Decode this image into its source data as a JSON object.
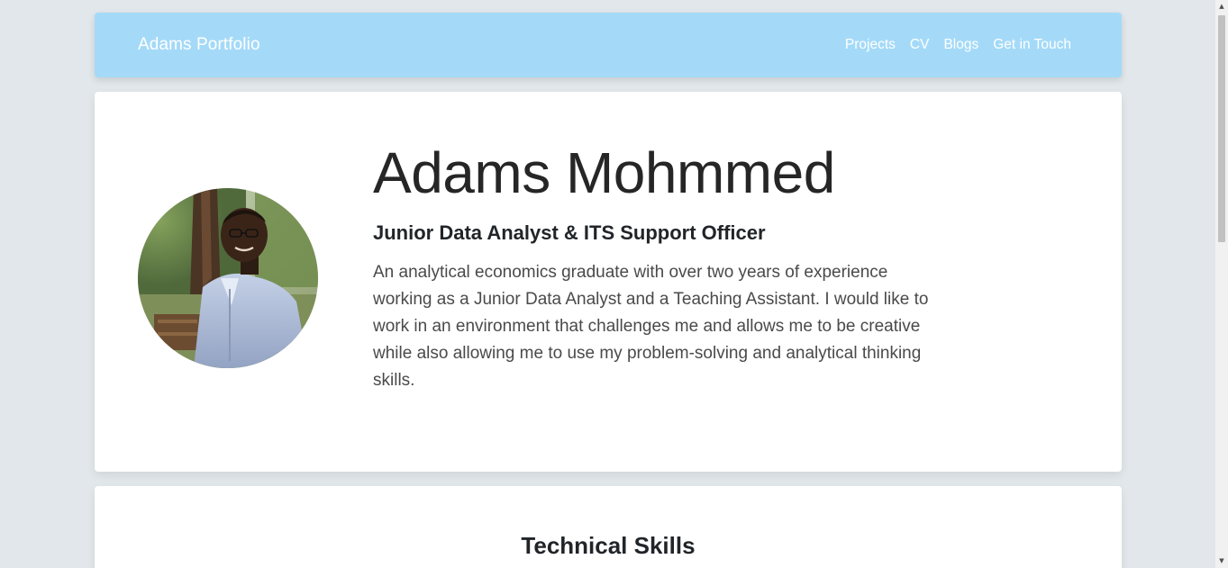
{
  "navbar": {
    "brand": "Adams Portfolio",
    "links": [
      "Projects",
      "CV",
      "Blogs",
      "Get in Touch"
    ],
    "background": "#a4daf8"
  },
  "hero": {
    "name": "Adams Mohmmed",
    "title": "Junior Data Analyst & ITS Support Officer",
    "description": "An analytical economics graduate with over two years of experience working as a Junior Data Analyst and a Teaching Assistant. I would like to work in an environment that challenges me and allows me to be creative while also allowing me to use my problem-solving and analytical thinking skills."
  },
  "skills": {
    "heading": "Technical Skills"
  },
  "scrollbar": {
    "up_icon": "triangle-up",
    "down_icon": "triangle-down"
  }
}
